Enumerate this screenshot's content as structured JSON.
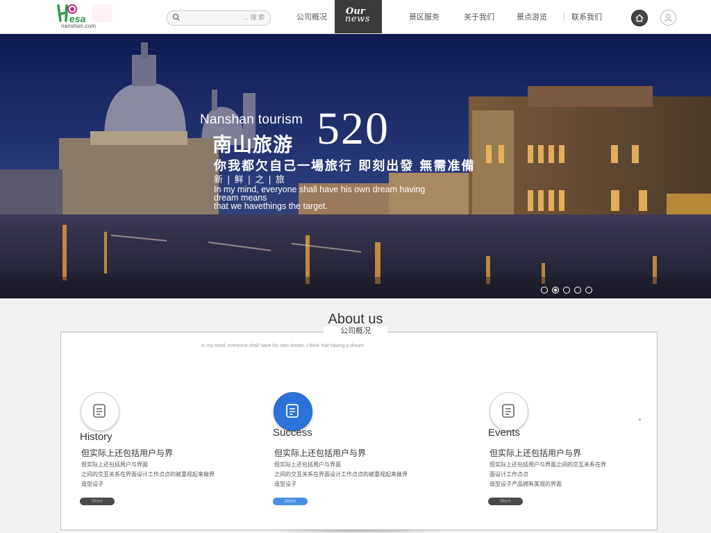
{
  "header": {
    "logo_text": "Hesa",
    "logo_domain": "nanshan.com",
    "search_placeholder": "... 搜 索",
    "nav": [
      {
        "label": "公司概况"
      },
      {
        "label": "Our",
        "label2": "news",
        "active": true
      },
      {
        "label": "景区服务"
      },
      {
        "label": "关于我们"
      },
      {
        "label": "景点游览"
      },
      {
        "label": "联系我们"
      }
    ]
  },
  "hero": {
    "title_en": "Nanshan tourism",
    "title_cn": "南山旅游",
    "number": "520",
    "slogan": "你我都欠自己一場旅行 即刻出發 無需准備",
    "fresh": "新 | 鲜 | 之 | 旅",
    "body_line1": "In my mind, everyone shall have his own dream having",
    "body_line2": "dream means",
    "body_line3": "that we havethings the target.",
    "dots": 5,
    "active_dot": 2
  },
  "about": {
    "title": "About us",
    "subtitle": "公司概况",
    "tagline": "In my mind, everyone shall have his own dream. I think that having a dream",
    "features": [
      {
        "name": "History",
        "heading": "但实际上还包括用户与界",
        "desc1": "但实际上还包括用户与界面",
        "desc2": "之间的交互关系在界面设计工作点点的被重视起来做界",
        "desc3": "造型设子",
        "more": "More",
        "highlight": false
      },
      {
        "name": "Success",
        "heading": "但实际上还包括用户与界",
        "desc1": "但实际上还包括用户与界面",
        "desc2": "之间的交互关系在界面设计工作点点的被重视起来做界",
        "desc3": "造型设子",
        "more": "More",
        "highlight": true
      },
      {
        "name": "Events",
        "heading": "但实际上还包括用户与界",
        "desc1": "但实际上还包括用户与界面之间的交互关系在界",
        "desc2": "面设计工作点点",
        "desc3": "造型设子产品拥有美观的界面",
        "more": "More",
        "highlight": false
      }
    ]
  },
  "colors": {
    "accent_blue": "#2b73d8",
    "nav_active_bg": "#3b3b3b",
    "more_button": "#4a4a4a"
  }
}
